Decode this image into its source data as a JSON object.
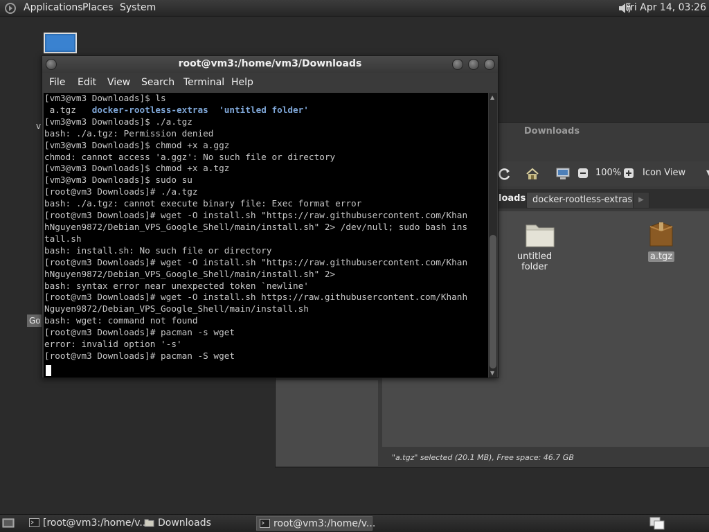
{
  "top_panel": {
    "menus": [
      "Applications",
      "Places",
      "System"
    ],
    "clock": "Fri Apr 14, 03:26"
  },
  "desktop": {
    "partial_label_1": "v",
    "partial_label_2": "Go"
  },
  "file_manager": {
    "title": "Downloads",
    "toolbar": {
      "zoom_level": "100%",
      "view_mode": "Icon View"
    },
    "path_bar": {
      "current_partial": "loads",
      "next_crumb": "docker-rootless-extras"
    },
    "files": [
      {
        "name": "untitled folder",
        "type": "folder-icon",
        "selected": false
      },
      {
        "name": "a.tgz",
        "type": "archive-icon",
        "selected": true
      }
    ],
    "status": "\"a.tgz\" selected (20.1 MB), Free space: 46.7 GB"
  },
  "terminal": {
    "title": "root@vm3:/home/vm3/Downloads",
    "menus": [
      "File",
      "Edit",
      "View",
      "Search",
      "Terminal",
      "Help"
    ],
    "ls_output": {
      "file": " a.tgz   ",
      "dir1": "docker-rootless-extras",
      "gap": "  ",
      "dir2": "'untitled folder'"
    },
    "lines": [
      "[vm3@vm3 Downloads]$ ls",
      "[vm3@vm3 Downloads]$ ./a.tgz",
      "bash: ./a.tgz: Permission denied",
      "[vm3@vm3 Downloads]$ chmod +x a.ggz",
      "chmod: cannot access 'a.ggz': No such file or directory",
      "[vm3@vm3 Downloads]$ chmod +x a.tgz",
      "[vm3@vm3 Downloads]$ sudo su",
      "[root@vm3 Downloads]# ./a.tgz",
      "bash: ./a.tgz: cannot execute binary file: Exec format error",
      "[root@vm3 Downloads]# wget -O install.sh \"https://raw.githubusercontent.com/Khan",
      "hNguyen9872/Debian_VPS_Google_Shell/main/install.sh\" 2> /dev/null; sudo bash ins",
      "tall.sh",
      "bash: install.sh: No such file or directory",
      "[root@vm3 Downloads]# wget -O install.sh \"https://raw.githubusercontent.com/Khan",
      "hNguyen9872/Debian_VPS_Google_Shell/main/install.sh\" 2>",
      "bash: syntax error near unexpected token `newline'",
      "[root@vm3 Downloads]# wget -O install.sh https://raw.githubusercontent.com/Khanh",
      "Nguyen9872/Debian_VPS_Google_Shell/main/install.sh",
      "bash: wget: command not found",
      "[root@vm3 Downloads]# pacman -s wget",
      "error: invalid option '-s'",
      "[root@vm3 Downloads]# pacman -S wget"
    ]
  },
  "taskbar": {
    "tasks": [
      {
        "label": "[root@vm3:/home/v...",
        "icon": "terminal-icon",
        "active": false
      },
      {
        "label": "Downloads",
        "icon": "folder-icon",
        "active": false
      },
      {
        "label": "root@vm3:/home/v...",
        "icon": "terminal-icon",
        "active": true
      }
    ]
  }
}
